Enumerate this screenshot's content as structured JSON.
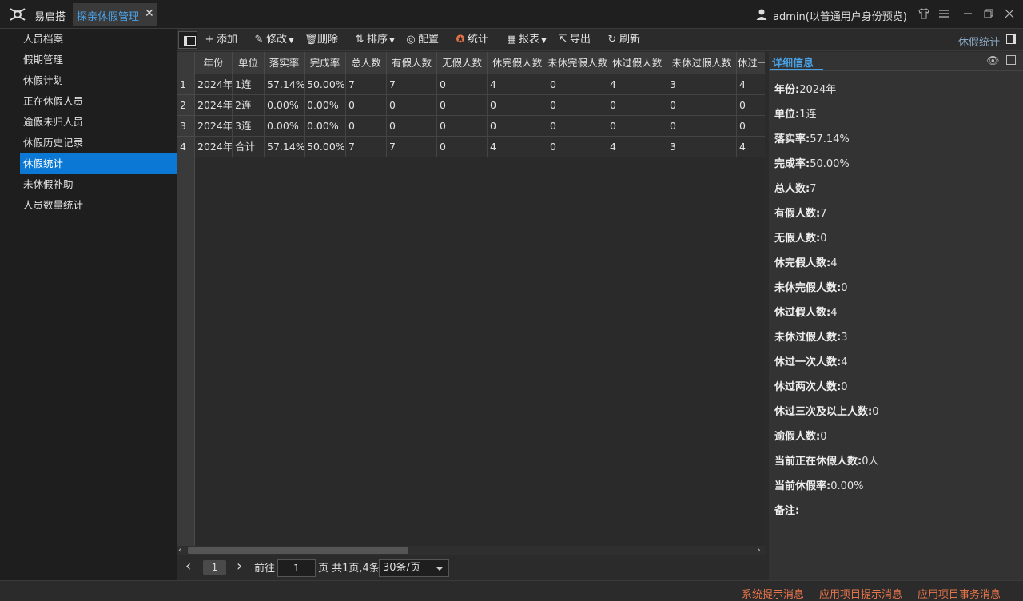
{
  "titlebar": {
    "app_name": "易启搭",
    "active_tab": "探亲休假管理",
    "close_glyph": "✕",
    "user_label": "admin(以普通用户身份预览)"
  },
  "sidebar": {
    "items": [
      {
        "label": "人员档案"
      },
      {
        "label": "假期管理"
      },
      {
        "label": "休假计划"
      },
      {
        "label": "正在休假人员"
      },
      {
        "label": "逾假未归人员"
      },
      {
        "label": "休假历史记录"
      },
      {
        "label": "休假统计",
        "active": true
      },
      {
        "label": "未休假补助"
      },
      {
        "label": "人员数量统计"
      }
    ]
  },
  "toolbar": {
    "add": "添加",
    "edit": "修改",
    "delete": "删除",
    "sort": "排序",
    "config": "配置",
    "stats": "统计",
    "report": "报表",
    "export": "导出",
    "refresh": "刷新",
    "breadcrumb": "休假统计"
  },
  "table": {
    "columns": [
      "年份",
      "单位",
      "落实率",
      "完成率",
      "总人数",
      "有假人数",
      "无假人数",
      "休完假人数",
      "未休完假人数",
      "休过假人数",
      "未休过假人数",
      "休过一"
    ],
    "rows": [
      {
        "num": "1",
        "cells": [
          "2024年",
          "1连",
          "57.14%",
          "50.00%",
          "7",
          "7",
          "0",
          "4",
          "0",
          "4",
          "3",
          "4"
        ]
      },
      {
        "num": "2",
        "cells": [
          "2024年",
          "2连",
          "0.00%",
          "0.00%",
          "0",
          "0",
          "0",
          "0",
          "0",
          "0",
          "0",
          "0"
        ]
      },
      {
        "num": "3",
        "cells": [
          "2024年",
          "3连",
          "0.00%",
          "0.00%",
          "0",
          "0",
          "0",
          "0",
          "0",
          "0",
          "0",
          "0"
        ]
      },
      {
        "num": "4",
        "cells": [
          "2024年",
          "合计",
          "57.14%",
          "50.00%",
          "7",
          "7",
          "0",
          "4",
          "0",
          "4",
          "3",
          "4"
        ]
      }
    ]
  },
  "pager": {
    "prev": "‹",
    "current": "1",
    "next": "›",
    "goto": "前往",
    "input_value": "1",
    "summary": "页 共1页,4条",
    "page_size": "30条/页"
  },
  "detail": {
    "tab": "详细信息",
    "fields": [
      {
        "label": "年份:",
        "value": "2024年"
      },
      {
        "label": "单位:",
        "value": "1连"
      },
      {
        "label": "落实率:",
        "value": "57.14%"
      },
      {
        "label": "完成率:",
        "value": "50.00%"
      },
      {
        "label": "总人数:",
        "value": "7"
      },
      {
        "label": "有假人数:",
        "value": "7"
      },
      {
        "label": "无假人数:",
        "value": "0"
      },
      {
        "label": "休完假人数:",
        "value": "4"
      },
      {
        "label": "未休完假人数:",
        "value": "0"
      },
      {
        "label": "休过假人数:",
        "value": "4"
      },
      {
        "label": "未休过假人数:",
        "value": "3"
      },
      {
        "label": "休过一次人数:",
        "value": "4"
      },
      {
        "label": "休过两次人数:",
        "value": "0"
      },
      {
        "label": "休过三次及以上人数:",
        "value": "0"
      },
      {
        "label": "逾假人数:",
        "value": "0"
      },
      {
        "label": "当前正在休假人数:",
        "value": "0人"
      },
      {
        "label": "当前休假率:",
        "value": "0.00%"
      },
      {
        "label": "备注:",
        "value": ""
      }
    ]
  },
  "statusbar": {
    "sys_msg": "系统提示消息",
    "app_msg": "应用项目提示消息",
    "biz_msg": "应用项目事务消息"
  },
  "colors": {
    "accent": "#4aa3e8",
    "active_item": "#0a78d4",
    "status_text": "#e8744a"
  }
}
